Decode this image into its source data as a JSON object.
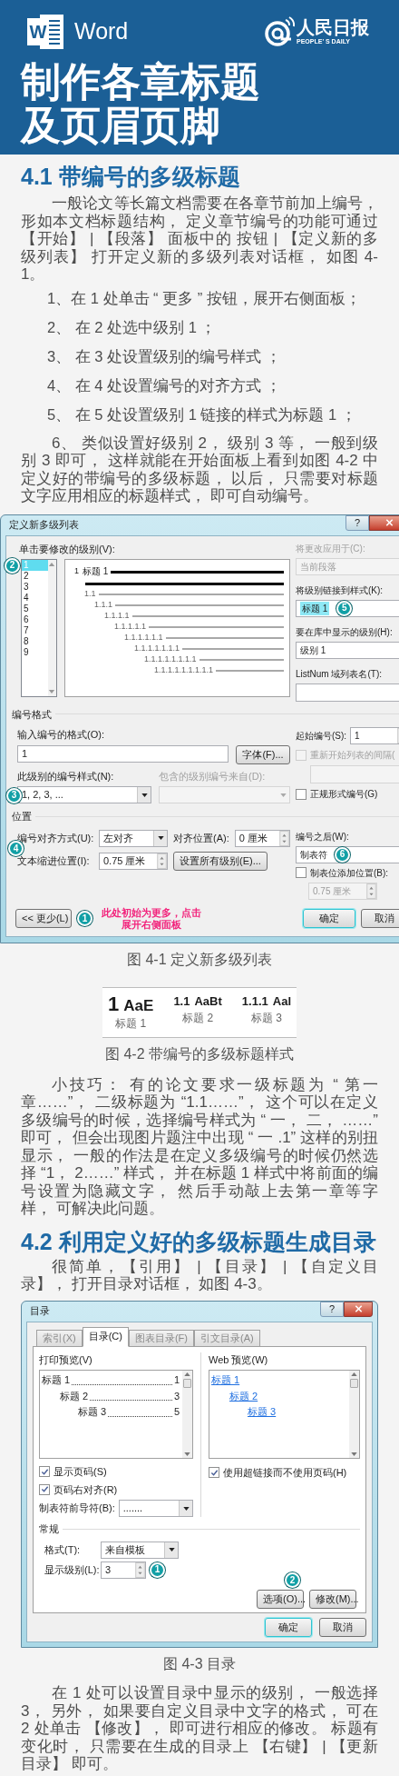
{
  "header": {
    "logo_letter": "W",
    "app_name": "Word",
    "brand": "人民日报",
    "brand_en": "PEOPLE' S DAILY",
    "title_lines": [
      "制作各章标题",
      "及页眉页脚"
    ]
  },
  "section_1": {
    "heading": "4.1 带编号的多级标题",
    "body": [
      {
        "kind": "paragraph",
        "text": "一般论文等长篇文档需要在各章节前加上编号，形如本文档标题结构， 定义章节编号的功能可通过【开始】 | 【段落】 面板中的 按钮 | 【定义新的多级列表】 打开定义新的多级列表对话框， 如图 4-1。"
      },
      {
        "kind": "step",
        "text": "1、在 1 处单击 “ 更多 ” 按钮，展开右侧面板；"
      },
      {
        "kind": "step",
        "text": "2、 在 2 处选中级别 1 ；"
      },
      {
        "kind": "step",
        "text": "3、 在 3 处设置级别的编号样式 ；"
      },
      {
        "kind": "step",
        "text": "4、 在 4 处设置编号的对齐方式 ；"
      },
      {
        "kind": "step",
        "text": "5、 在 5 处设置级别 1 链接的样式为标题 1 ；"
      },
      {
        "kind": "paragraph",
        "text": "6、 类似设置好级别 2， 级别 3 等， 一般到级别 3 即可， 这样就能在开始面板上看到如图 4-2 中定义好的带编号的多级标题， 以后， 只需要对标题文字应用相应的标题样式， 即可自动编号。"
      }
    ],
    "dialog": {
      "title": "定义新多级列表",
      "help": "?",
      "level_label": "单击要修改的级别(V):",
      "level_badge": "2",
      "levels": [
        {
          "label": "1",
          "selected": true
        },
        {
          "label": "2",
          "selected": false
        },
        {
          "label": "3",
          "selected": false
        },
        {
          "label": "4",
          "selected": false
        },
        {
          "label": "5",
          "selected": false
        },
        {
          "label": "6",
          "selected": false
        },
        {
          "label": "7",
          "selected": false
        },
        {
          "label": "8",
          "selected": false
        },
        {
          "label": "9",
          "selected": false
        }
      ],
      "preview": {
        "number": "1",
        "label": "标题 1",
        "children": [
          {
            "number": "1.1",
            "children": [
              {
                "number": "1.1.1",
                "children": [
                  {
                    "number": "1.1.1.1",
                    "children": [
                      {
                        "number": "1.1.1.1.1",
                        "children": [
                          {
                            "number": "1.1.1.1.1.1",
                            "children": [
                              {
                                "number": "1.1.1.1.1.1.1",
                                "children": [
                                  {
                                    "number": "1.1.1.1.1.1.1.1",
                                    "children": [
                                      {
                                        "number": "1.1.1.1.1.1.1.1.1"
                                      }
                                    ]
                                  }
                                ]
                              }
                            ]
                          }
                        ]
                      }
                    ]
                  }
                ]
              }
            ]
          }
        ]
      },
      "apply_label": "将更改应用于(C):",
      "apply_value": "当前段落",
      "link_label": "将级别链接到样式(K):",
      "link_value": "标题 1",
      "link_badge": "5",
      "gallery_label": "要在库中显示的级别(H):",
      "gallery_value": "级别 1",
      "listnum_label": "ListNum 域列表名(T):",
      "format_section": "编号格式",
      "format_label": "输入编号的格式(O):",
      "format_value": "1",
      "font_button": "字体(F)...",
      "style_label": "此级别的编号样式(N):",
      "style_value": "1, 2, 3, ...",
      "style_badge": "3",
      "include_label": "包含的级别编号来自(D):",
      "start_label": "起始编号(S):",
      "start_value": "1",
      "restart": {
        "label": "重新开始列表的间隔(",
        "checked": false,
        "disabled": true
      },
      "legal": {
        "label": "正规形式编号(G)",
        "checked": false,
        "disabled": false
      },
      "position_section": "位置",
      "align_label": "编号对齐方式(U):",
      "align_value": "左对齐",
      "align_badge": "4",
      "at_label": "对齐位置(A):",
      "at_value": "0 厘米",
      "indent_label": "文本缩进位置(I):",
      "indent_value": "0.75 厘米",
      "set_all_button": "设置所有级别(E)...",
      "after_label": "编号之后(W):",
      "after_value": "制表符",
      "after_badge": "6",
      "tab_stop": {
        "label": "制表位添加位置(B):",
        "checked": false,
        "disabled": false
      },
      "tab_stop_value": "0.75 厘米",
      "less_button": "<< 更少(L)",
      "less_badge": "1",
      "note": "此处初始为更多，点击展开右侧面板",
      "ok_button": "确定",
      "cancel_button": "取消"
    },
    "caption_1": "图 4-1 定义新多级列表",
    "styles": [
      {
        "number": "1",
        "sample": "AaE",
        "name": "标题 1"
      },
      {
        "number": "1.1",
        "sample": "AaBt",
        "name": "标题 2"
      },
      {
        "number": "1.1.1",
        "sample": "Aal",
        "name": "标题 3"
      }
    ],
    "caption_2": "图 4-2 带编号的多级标题样式",
    "tip": "小技巧： 有的论文要求一级标题为 “ 第一章……”， 二级标题为 “1.1……”， 这个可以在定义多级编号的时候，选择编号样式为 “ 一， 二， ……” 即可， 但会出现图片题注中出现 “ 一 .1” 这样的别扭显示， 一般的作法是在定义多级编号的时候仍然选择 “1， 2……” 样式， 并在标题 1 样式中将前面的编号设置为隐藏文字， 然后手动敲上去第一章等字样， 可解决此问题。"
  },
  "section_2": {
    "heading": "4.2 利用定义好的多级标题生成目录",
    "intro": "很简单，【引用】 | 【目录】 | 【自定义目录】， 打开目录对话框， 如图 4-3。",
    "dialog": {
      "title": "目录",
      "help": "?",
      "tabs": [
        {
          "label": "索引(X)",
          "selected": false
        },
        {
          "label": "目录(C)",
          "selected": true
        },
        {
          "label": "图表目录(F)",
          "selected": false
        },
        {
          "label": "引文目录(A)",
          "selected": false
        }
      ],
      "print_label": "打印预览(V)",
      "print_preview": {
        "text": "标题 1",
        "page": "1",
        "children": [
          {
            "text": "标题 2",
            "page": "3",
            "children": [
              {
                "text": "标题 3",
                "page": "5"
              }
            ]
          }
        ]
      },
      "web_label": "Web 预览(W)",
      "web_preview": {
        "text": "标题 1",
        "children": [
          {
            "text": "标题 2",
            "children": [
              {
                "text": "标题 3"
              }
            ]
          }
        ]
      },
      "show_pages": {
        "label": "显示页码(S)",
        "checked": true
      },
      "right_align": {
        "label": "页码右对齐(R)",
        "checked": true
      },
      "hyperlinks": {
        "label": "使用超链接而不使用页码(H)",
        "checked": true
      },
      "leader_label": "制表符前导符(B):",
      "leader_value": ".......",
      "general_section": "常规",
      "format_label": "格式(T):",
      "format_value": "来自模板",
      "levels_label": "显示级别(L):",
      "levels_value": "3",
      "levels_badge": "1",
      "modify_badge": "2",
      "options_button": "选项(O)...",
      "modify_button": "修改(M)...",
      "ok_button": "确定",
      "cancel_button": "取消"
    },
    "caption": "图 4-3 目录",
    "outro": "在 1 处可以设置目录中显示的级别， 一般选择 3， 另外， 如果要自定义目录中文字的格式， 可在 2 处单击 【修改】， 即可进行相应的修改。 标题有变化时， 只需要在生成的目录上 【右键】 | 【更新目录】 即可。"
  }
}
